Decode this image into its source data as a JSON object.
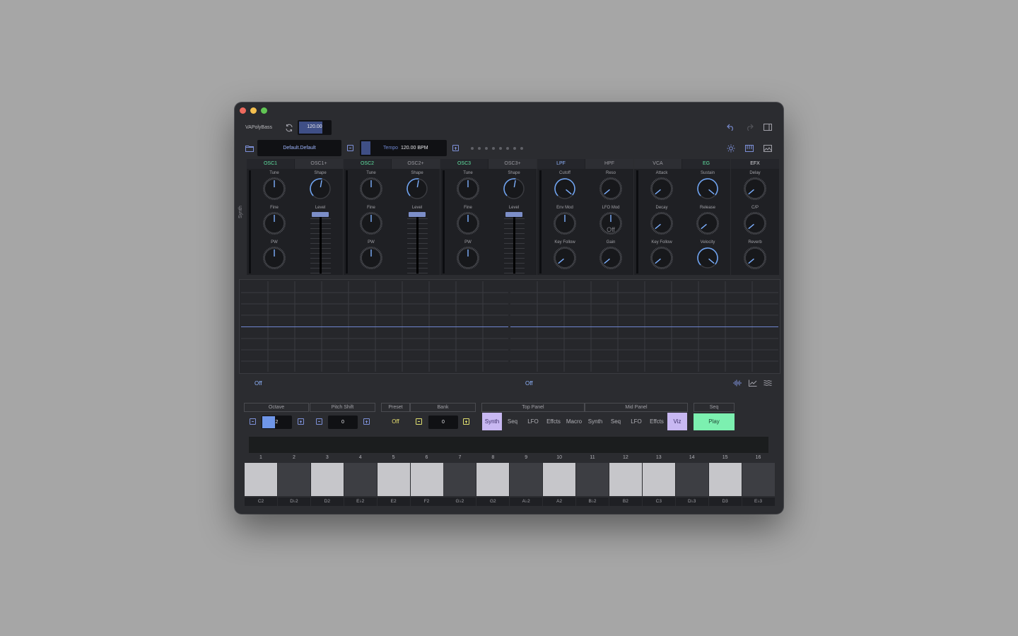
{
  "app": {
    "title": "VAPolyBass",
    "tempo_value": "120.00"
  },
  "toolbar": {
    "preset_name": "Default.Default",
    "tempo_label": "Tempo",
    "tempo_value": "120.00 BPM"
  },
  "synth_label": "Synth",
  "modules": {
    "osc1": {
      "tab_main": "OSC1",
      "tab_alt": "OSC1+",
      "tune": "Tune",
      "shape": "Shape",
      "fine": "Fine",
      "level": "Level",
      "pw": "PW"
    },
    "osc2": {
      "tab_main": "OSC2",
      "tab_alt": "OSC2+",
      "tune": "Tune",
      "shape": "Shape",
      "fine": "Fine",
      "level": "Level",
      "pw": "PW"
    },
    "osc3": {
      "tab_main": "OSC3",
      "tab_alt": "OSC3+",
      "tune": "Tune",
      "shape": "Shape",
      "fine": "Fine",
      "level": "Level",
      "pw": "PW"
    },
    "filter": {
      "tab_main": "LPF",
      "tab_alt": "HPF",
      "cutoff": "Cutoff",
      "reso": "Reso",
      "envmod": "Env Mod",
      "lfomod": "LFO Mod",
      "lfomod_value": "Off",
      "keyfollow": "Key Follow",
      "gain": "Gain"
    },
    "amp": {
      "tab_main": "VCA",
      "tab_alt": "EG",
      "attack": "Attack",
      "sustain": "Sustain",
      "decay": "Decay",
      "release": "Release",
      "keyfollow": "Key Follow",
      "velocity": "Velocity"
    },
    "efx": {
      "tab": "EFX",
      "delay": "Delay",
      "cp": "C/P",
      "reverb": "Reverb"
    }
  },
  "viz": {
    "left_status": "Off",
    "right_status": "Off"
  },
  "controls": {
    "octave_label": "Octave",
    "octave_value": "2",
    "pitch_shift_label": "Pitch Shift",
    "pitch_shift_value": "0",
    "preset_label": "Preset",
    "preset_value": "Off",
    "bank_label": "Bank",
    "bank_value": "0",
    "top_panel_label": "Top Panel",
    "mid_panel_label": "Mid Panel",
    "seq_label": "Seq",
    "top_panel_buttons": [
      "Synth",
      "Seq",
      "LFO",
      "Effcts",
      "Macro"
    ],
    "mid_panel_buttons": [
      "Synth",
      "Seq",
      "LFO",
      "Effcts",
      "Viz"
    ],
    "play_label": "Play"
  },
  "colors": {
    "accent_green": "#7cf0b0",
    "accent_purple": "#c8b8f2",
    "accent_blue": "#8fb4ff"
  },
  "steps": [
    {
      "num": "1",
      "note": "C2",
      "on": true
    },
    {
      "num": "2",
      "note": "D♭2",
      "on": false
    },
    {
      "num": "3",
      "note": "D2",
      "on": true
    },
    {
      "num": "4",
      "note": "E♭2",
      "on": false
    },
    {
      "num": "5",
      "note": "E2",
      "on": true
    },
    {
      "num": "6",
      "note": "F2",
      "on": true
    },
    {
      "num": "7",
      "note": "G♭2",
      "on": false
    },
    {
      "num": "8",
      "note": "G2",
      "on": true
    },
    {
      "num": "9",
      "note": "A♭2",
      "on": false
    },
    {
      "num": "10",
      "note": "A2",
      "on": true
    },
    {
      "num": "11",
      "note": "B♭2",
      "on": false
    },
    {
      "num": "12",
      "note": "B2",
      "on": true
    },
    {
      "num": "13",
      "note": "C3",
      "on": true
    },
    {
      "num": "14",
      "note": "D♭3",
      "on": false
    },
    {
      "num": "15",
      "note": "D3",
      "on": true
    },
    {
      "num": "16",
      "note": "E♭3",
      "on": false
    }
  ]
}
